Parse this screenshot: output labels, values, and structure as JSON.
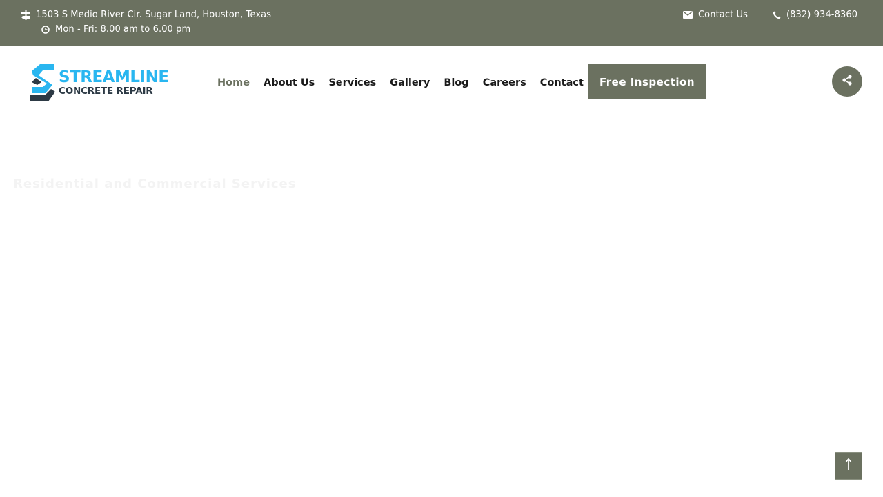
{
  "topbar": {
    "address": "1503 S Medio River Cir. Sugar Land, Houston, Texas",
    "hours": "Mon - Fri: 8.00 am to 6.00 pm",
    "contact_label": "Contact Us",
    "phone": "(832) 934-8360"
  },
  "header": {
    "logo": {
      "line1": "STREAMLINE",
      "line2": "CONCRETE REPAIR"
    },
    "nav": [
      "Home",
      "About Us",
      "Services",
      "Gallery",
      "Blog",
      "Careers",
      "Contact"
    ],
    "active_nav": "Home",
    "cta_label": "Free Inspection",
    "share_icon": "share-icon"
  },
  "hero": {
    "subtitle": "Residential and Commercial Services"
  },
  "scroll_top_icon": "arrow-up-icon",
  "colors": {
    "primary": "#6b7160",
    "logo_blue": "#29b6f0",
    "logo_dark": "#2d3a45"
  }
}
